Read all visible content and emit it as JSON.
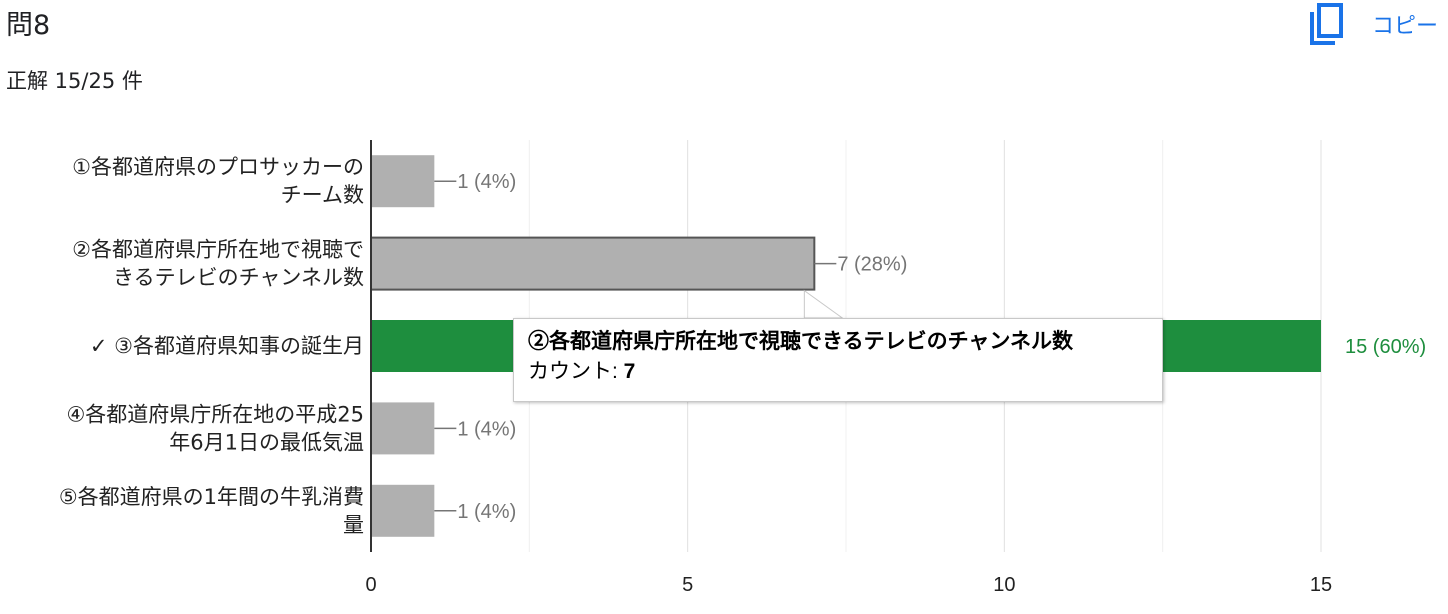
{
  "question": {
    "title": "問8",
    "score_text": "正解 15/25 件",
    "copy_label": "コピー",
    "copy_icon": "copy-icon"
  },
  "tooltip": {
    "title": "②各都道府県庁所在地で視聴できるテレビのチャンネル数",
    "count_label": "カウント: ",
    "count_value": "7"
  },
  "colors": {
    "bar": "#b0b0b0",
    "correct_bar": "#1e8e3e",
    "correct_label": "#1e8e3e",
    "value_label": "#757575",
    "accent": "#1a73e8"
  },
  "chart_data": {
    "type": "bar",
    "orientation": "horizontal",
    "categories": [
      [
        "①各都道府県のプロサッカーの",
        "チーム数"
      ],
      [
        "②各都道府県庁所在地で視聴で",
        "きるテレビのチャンネル数"
      ],
      [
        "✓ ③各都道府県知事の誕生月"
      ],
      [
        "④各都道府県庁所在地の平成25",
        "年6月1日の最低気温"
      ],
      [
        "⑤各都道府県の1年間の牛乳消費",
        "量"
      ]
    ],
    "values": [
      1,
      7,
      15,
      1,
      1
    ],
    "value_labels": [
      "1 (4%)",
      "7 (28%)",
      "15 (60%)",
      "1 (4%)",
      "1 (4%)"
    ],
    "correct": [
      false,
      false,
      true,
      false,
      false
    ],
    "highlighted_index": 1,
    "xlim": [
      0,
      15
    ],
    "xticks": [
      "0",
      "5",
      "10",
      "15"
    ],
    "grid": true,
    "title": "",
    "xlabel": "",
    "ylabel": ""
  }
}
